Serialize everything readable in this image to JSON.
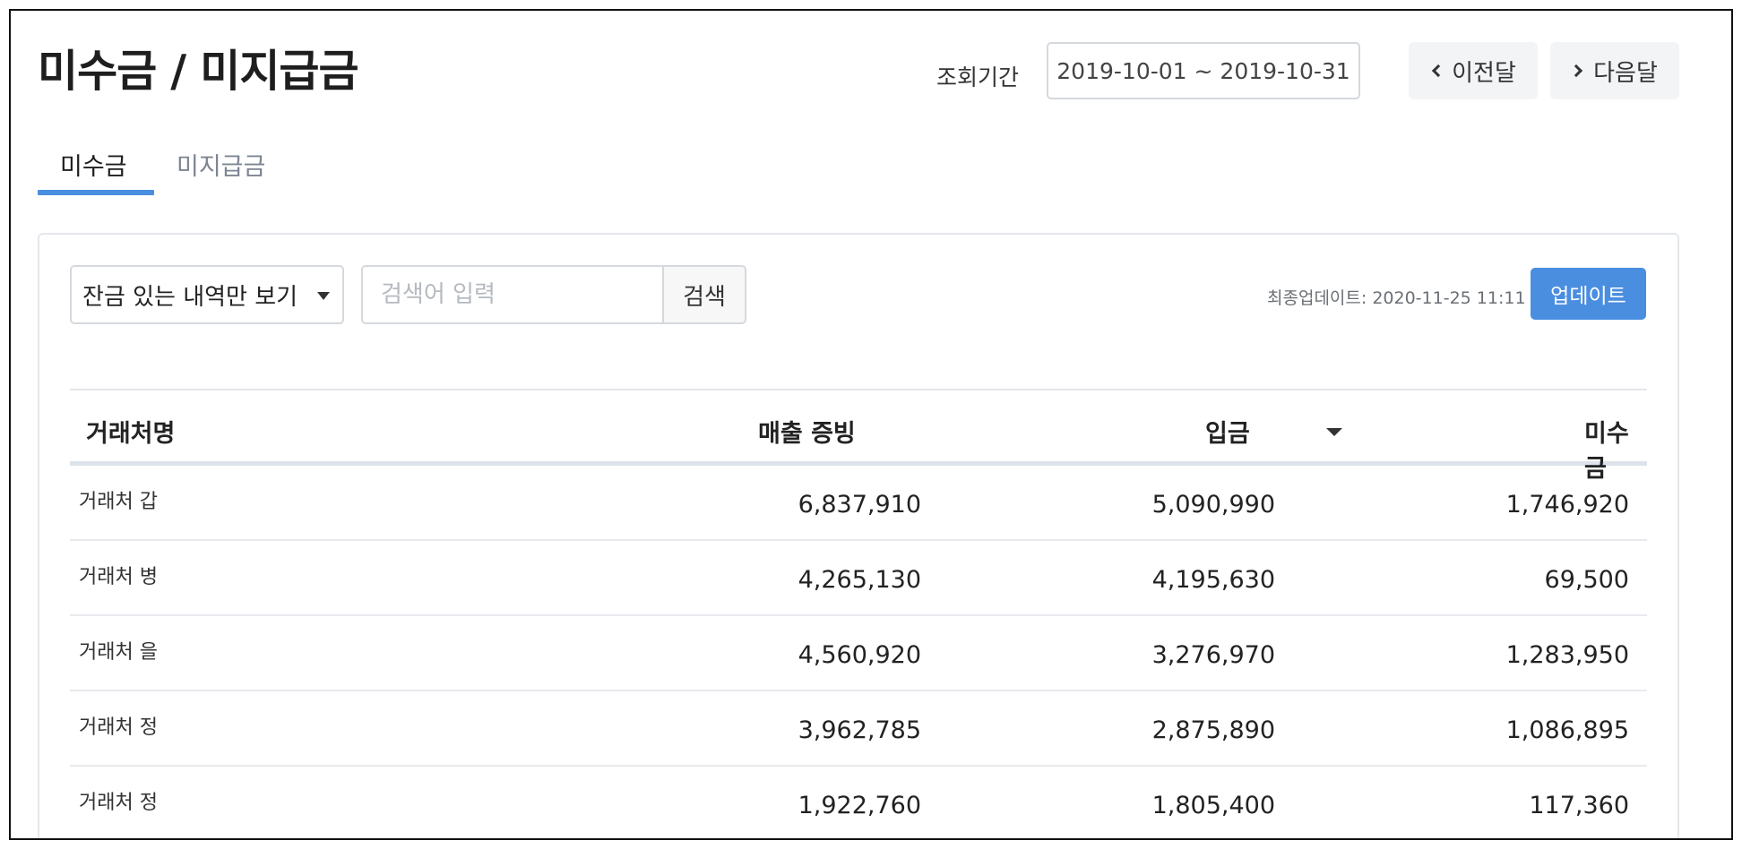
{
  "header": {
    "title": "미수금 / 미지급금",
    "period_label": "조회기간",
    "date_range": "2019-10-01 ~ 2019-10-31",
    "prev_label": "이전달",
    "next_label": "다음달"
  },
  "tabs": [
    {
      "label": "미수금",
      "active": true
    },
    {
      "label": "미지급금",
      "active": false
    }
  ],
  "toolbar": {
    "filter_selected": "잔금 있는 내역만 보기",
    "search_placeholder": "검색어 입력",
    "search_label": "검색",
    "last_update": "최종업데이트: 2020-11-25 11:11",
    "update_label": "업데이트"
  },
  "table": {
    "columns": [
      "거래처명",
      "매출 증빙",
      "입금",
      "미수금"
    ],
    "rows": [
      {
        "name": "거래처 갑",
        "sales": "6,837,910",
        "paid": "5,090,990",
        "unpaid": "1,746,920"
      },
      {
        "name": "거래처 병",
        "sales": "4,265,130",
        "paid": "4,195,630",
        "unpaid": "69,500"
      },
      {
        "name": "거래처 을",
        "sales": "4,560,920",
        "paid": "3,276,970",
        "unpaid": "1,283,950"
      },
      {
        "name": "거래처 정",
        "sales": "3,962,785",
        "paid": "2,875,890",
        "unpaid": "1,086,895"
      },
      {
        "name": "거래처 정",
        "sales": "1,922,760",
        "paid": "1,805,400",
        "unpaid": "117,360"
      }
    ]
  },
  "colors": {
    "accent": "#4a8ee0",
    "inactive_tab": "#7d8592",
    "border": "#d5d9de"
  }
}
